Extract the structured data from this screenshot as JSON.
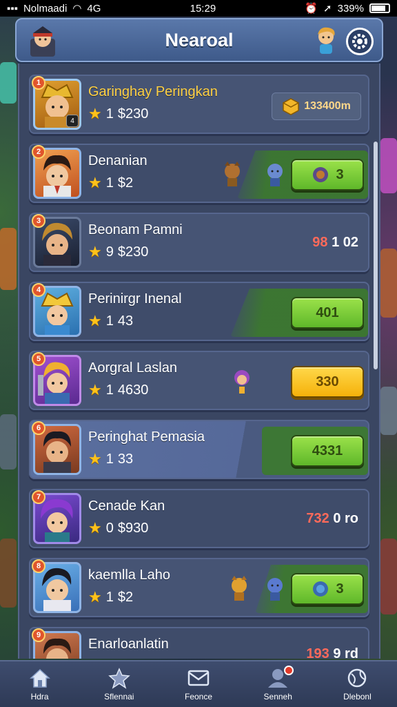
{
  "status_bar": {
    "carrier": "Nolmaadi",
    "network": "4G",
    "time": "15:29",
    "battery": "339%"
  },
  "header": {
    "title": "Nearoal"
  },
  "rows": [
    {
      "name": "Garinghay Peringkan",
      "rank": "1",
      "stat_prefix": "1",
      "stat": "$230",
      "action_type": "coins",
      "action_label": "133400m"
    },
    {
      "name": "Denanian",
      "rank": "2",
      "stat_prefix": "1",
      "stat": "$2",
      "action_type": "green",
      "action_label": "3"
    },
    {
      "name": "Beonam Pamni",
      "rank": "3",
      "stat_prefix": "9",
      "stat": "$230",
      "action_type": "score",
      "score_red": "98",
      "score_white": "1 02"
    },
    {
      "name": "Perinirgr Inenal",
      "rank": "4",
      "stat_prefix": "1",
      "stat": "43",
      "action_type": "green",
      "action_label": "401"
    },
    {
      "name": "Aorgral Laslan",
      "rank": "5",
      "stat_prefix": "1",
      "stat": "4630",
      "action_type": "yellow",
      "action_label": "330"
    },
    {
      "name": "Peringhat Pemasia",
      "rank": "6",
      "stat_prefix": "1",
      "stat": "33",
      "action_type": "green",
      "action_label": "4331"
    },
    {
      "name": "Cenade Kan",
      "rank": "7",
      "stat_prefix": "0",
      "stat": "$930",
      "action_type": "score",
      "score_red": "732",
      "score_white": "0 ro"
    },
    {
      "name": "kaemlla Laho",
      "rank": "8",
      "stat_prefix": "1",
      "stat": "$2",
      "action_type": "green",
      "action_label": "3"
    },
    {
      "name": "Enarloanlatin",
      "rank": "9",
      "stat_prefix": "",
      "stat": "",
      "action_type": "score",
      "score_red": "193",
      "score_white": "9 rd"
    }
  ],
  "nav": [
    {
      "label": "Hdra",
      "icon": "home-icon"
    },
    {
      "label": "Sflennai",
      "icon": "star-icon"
    },
    {
      "label": "Feonce",
      "icon": "mail-icon"
    },
    {
      "label": "Senneh",
      "icon": "profile-icon"
    },
    {
      "label": "Dlebonl",
      "icon": "globe-icon"
    }
  ],
  "colors": {
    "accent_green": "#5fb82a",
    "accent_yellow": "#f5b10a",
    "header_blue": "#4a6798",
    "gold_name": "#ffd043"
  }
}
